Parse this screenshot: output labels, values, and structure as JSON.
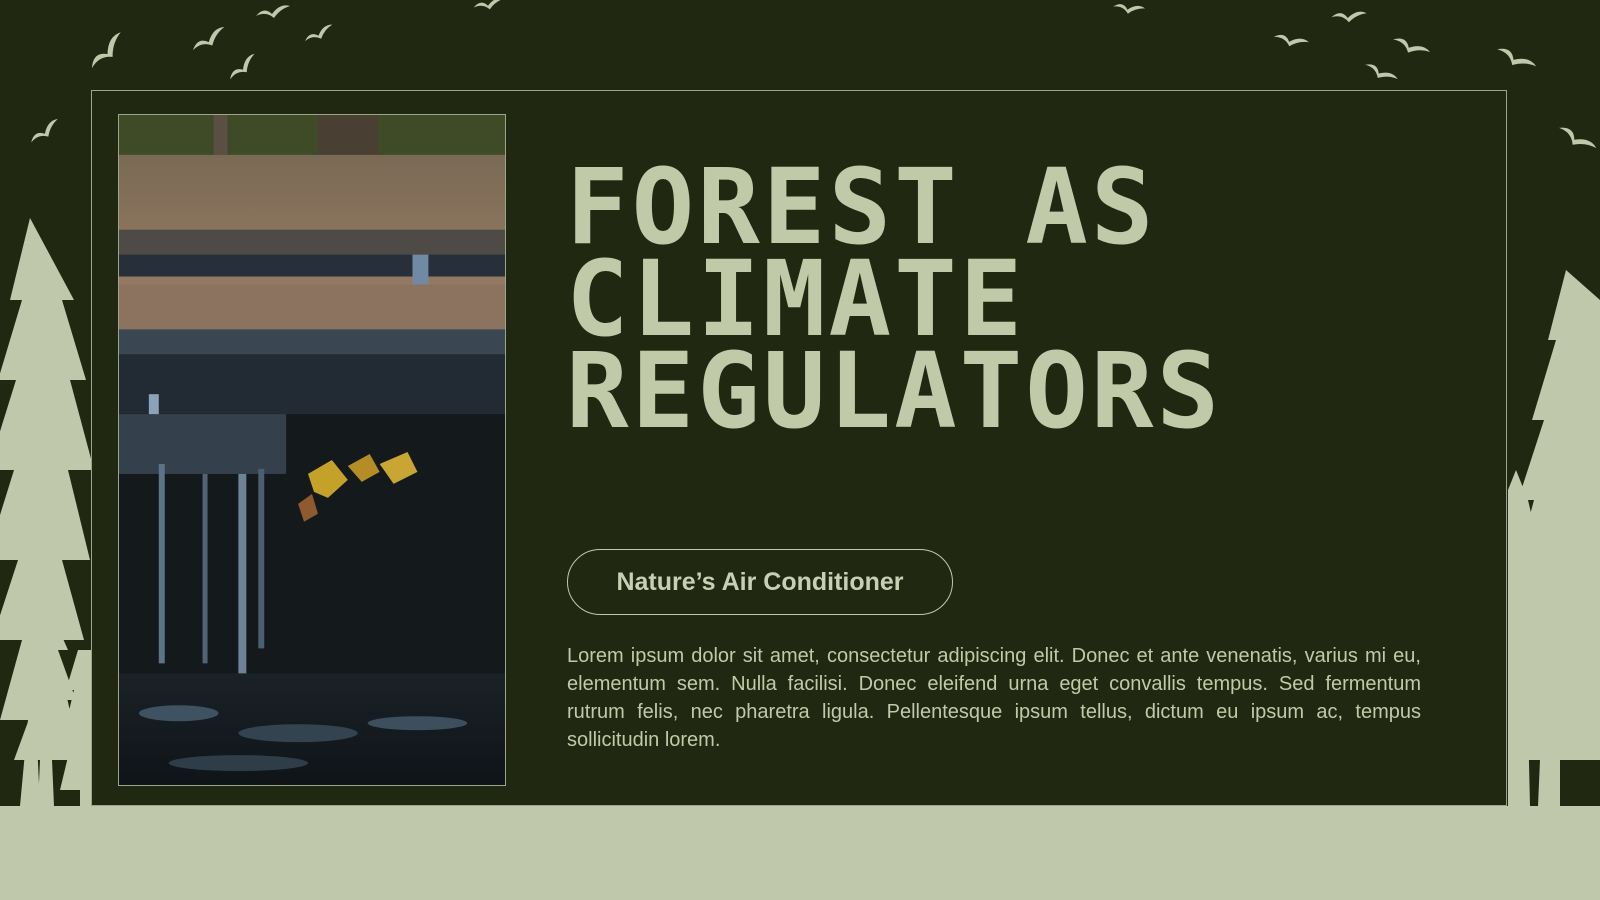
{
  "slide": {
    "title_lines": [
      "Forest as",
      "Climate",
      "Regulators"
    ],
    "subtitle_pill": "Nature’s Air Conditioner",
    "body": "Lorem ipsum dolor sit amet, consectetur adipiscing elit. Donec et ante venenatis, varius mi eu, elementum sem. Nulla facilisi. Donec eleifend urna eget convallis tempus. Sed fermentum rutrum felis, nec pharetra ligula. Pellentesque ipsum tellus, dictum eu ipsum ac, tempus sollicitudin lorem."
  },
  "colors": {
    "background": "#212812",
    "accent_sage": "#c0c9a8",
    "frame_border": "#9aa68a"
  },
  "decorations": {
    "silhouettes": [
      "flying-birds",
      "pine-trees",
      "forest-floor"
    ],
    "photo": "forest-waterfall-autumn-leaves"
  }
}
